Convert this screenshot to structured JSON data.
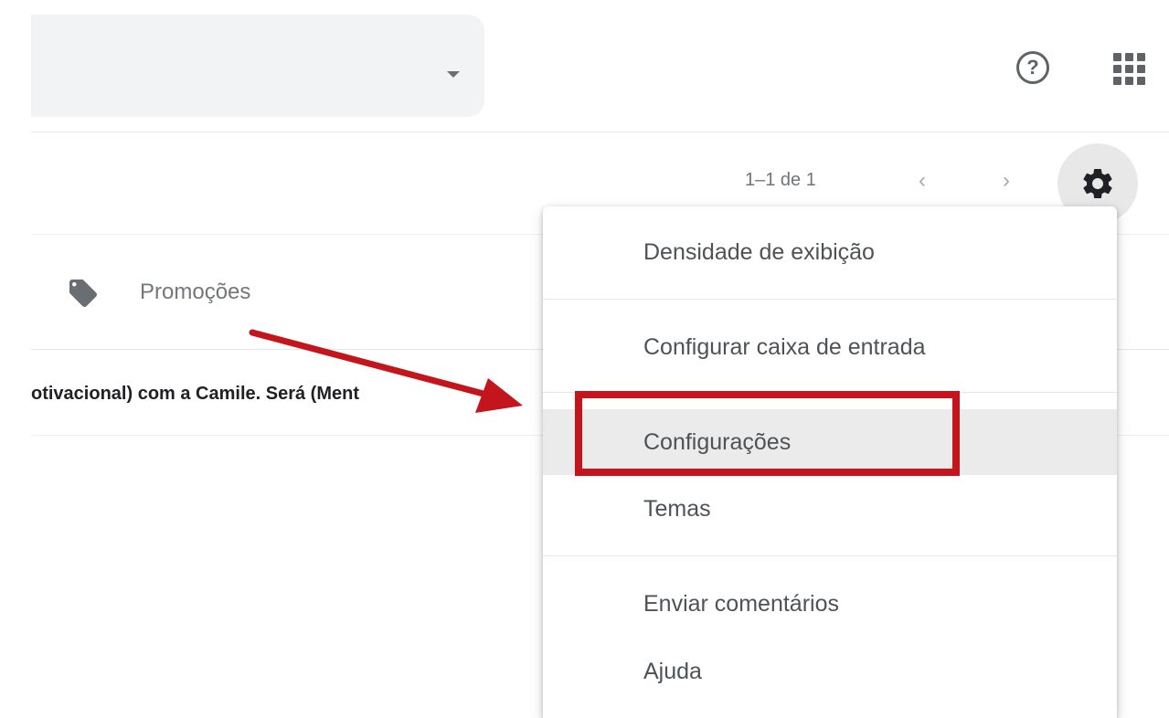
{
  "header": {
    "search_dropdown_icon": "caret-down",
    "help_icon": "help-circle",
    "apps_icon": "apps-grid"
  },
  "toolbar": {
    "pagination": "1–1 de 1",
    "prev_icon": "chevron-left",
    "next_icon": "chevron-right",
    "settings_icon": "gear"
  },
  "tabs": [
    {
      "label": "Promoções",
      "icon": "tag"
    }
  ],
  "email_list": [
    {
      "snippet": "otivacional) com a Camile. Será (Ment"
    }
  ],
  "settings_menu": {
    "items": [
      {
        "label": "Densidade de exibição"
      },
      {
        "label": "Configurar caixa de entrada"
      },
      {
        "label": "Configurações",
        "highlighted": true
      },
      {
        "label": "Temas"
      },
      {
        "label": "Enviar comentários"
      },
      {
        "label": "Ajuda"
      }
    ]
  },
  "annotation": {
    "color": "#c4141c",
    "target": "Configurações"
  }
}
